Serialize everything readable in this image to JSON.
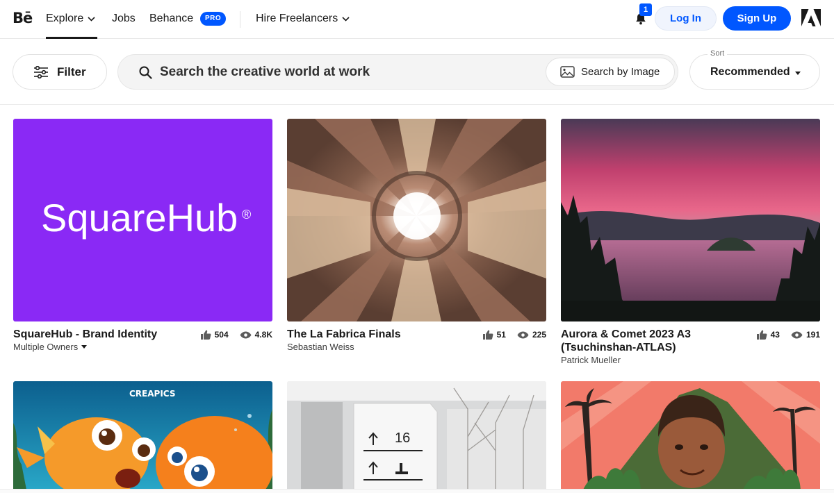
{
  "header": {
    "logo": "Bē",
    "nav": {
      "explore": "Explore",
      "jobs": "Jobs",
      "behance": "Behance",
      "pro_badge": "PRO",
      "hire": "Hire Freelancers"
    },
    "notification_count": "1",
    "login_label": "Log In",
    "signup_label": "Sign Up"
  },
  "toolbar": {
    "filter_label": "Filter",
    "search_placeholder": "Search the creative world at work",
    "search_by_image_label": "Search by Image",
    "sort_caption": "Sort",
    "sort_value": "Recommended"
  },
  "projects": [
    {
      "title": "SquareHub - Brand Identity",
      "owner": "Multiple Owners",
      "likes": "504",
      "views": "4.8K",
      "cover_text": "SquareHub",
      "cover_mark": "®",
      "cover_color": "#8a29f5"
    },
    {
      "title": "The La Fabrica Finals",
      "owner": "Sebastian Weiss",
      "likes": "51",
      "views": "225"
    },
    {
      "title": "Aurora & Comet 2023 A3 (Tsuchinshan-ATLAS)",
      "owner": "Patrick Mueller",
      "likes": "43",
      "views": "191"
    },
    {
      "title": "",
      "owner": "",
      "cover_text": "CREAPICS"
    },
    {
      "title": "",
      "owner": "",
      "cover_sign_number": "16"
    },
    {
      "title": "",
      "owner": ""
    }
  ],
  "colors": {
    "accent": "#0057ff",
    "text": "#191919"
  }
}
